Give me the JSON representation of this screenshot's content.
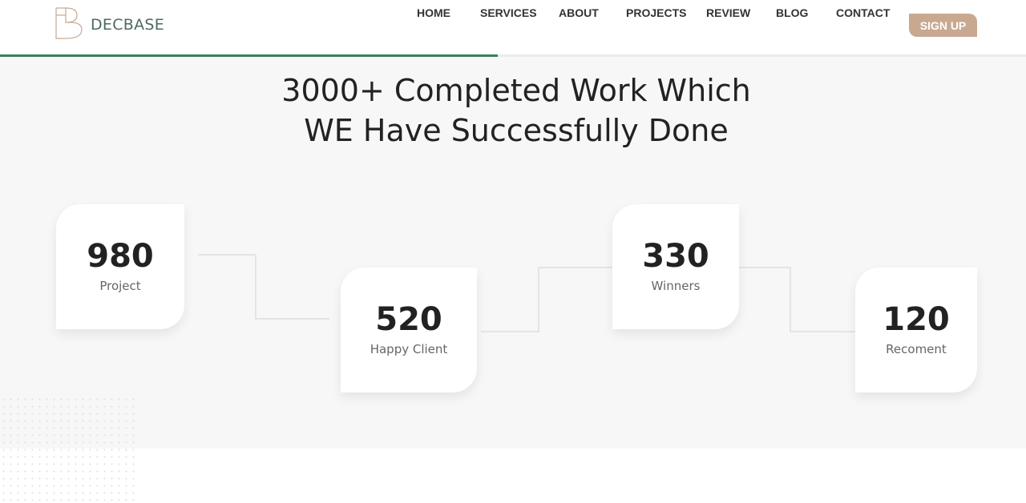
{
  "brand": {
    "name": "DECBASE"
  },
  "nav": {
    "items": [
      "HOME",
      "SERVICES",
      "ABOUT",
      "PROJECTS",
      "REVIEW",
      "BLOG",
      "CONTACT"
    ],
    "signup_label": "SIGN UP"
  },
  "scroll_progress": 0.485,
  "hero": {
    "line1": "3000+ Completed Work Which",
    "line2": "WE Have Successfully Done"
  },
  "stats": [
    {
      "value": "980",
      "label": "Project"
    },
    {
      "value": "520",
      "label": "Happy Client"
    },
    {
      "value": "330",
      "label": "Winners"
    },
    {
      "value": "120",
      "label": "Recoment"
    }
  ],
  "colors": {
    "accent_green": "#3c7d5b",
    "button_tan": "#c9a891",
    "logo_tan": "#c9a891",
    "logo_text": "#4d6b5e"
  },
  "icons": {
    "logo": "db-monogram-logo"
  }
}
